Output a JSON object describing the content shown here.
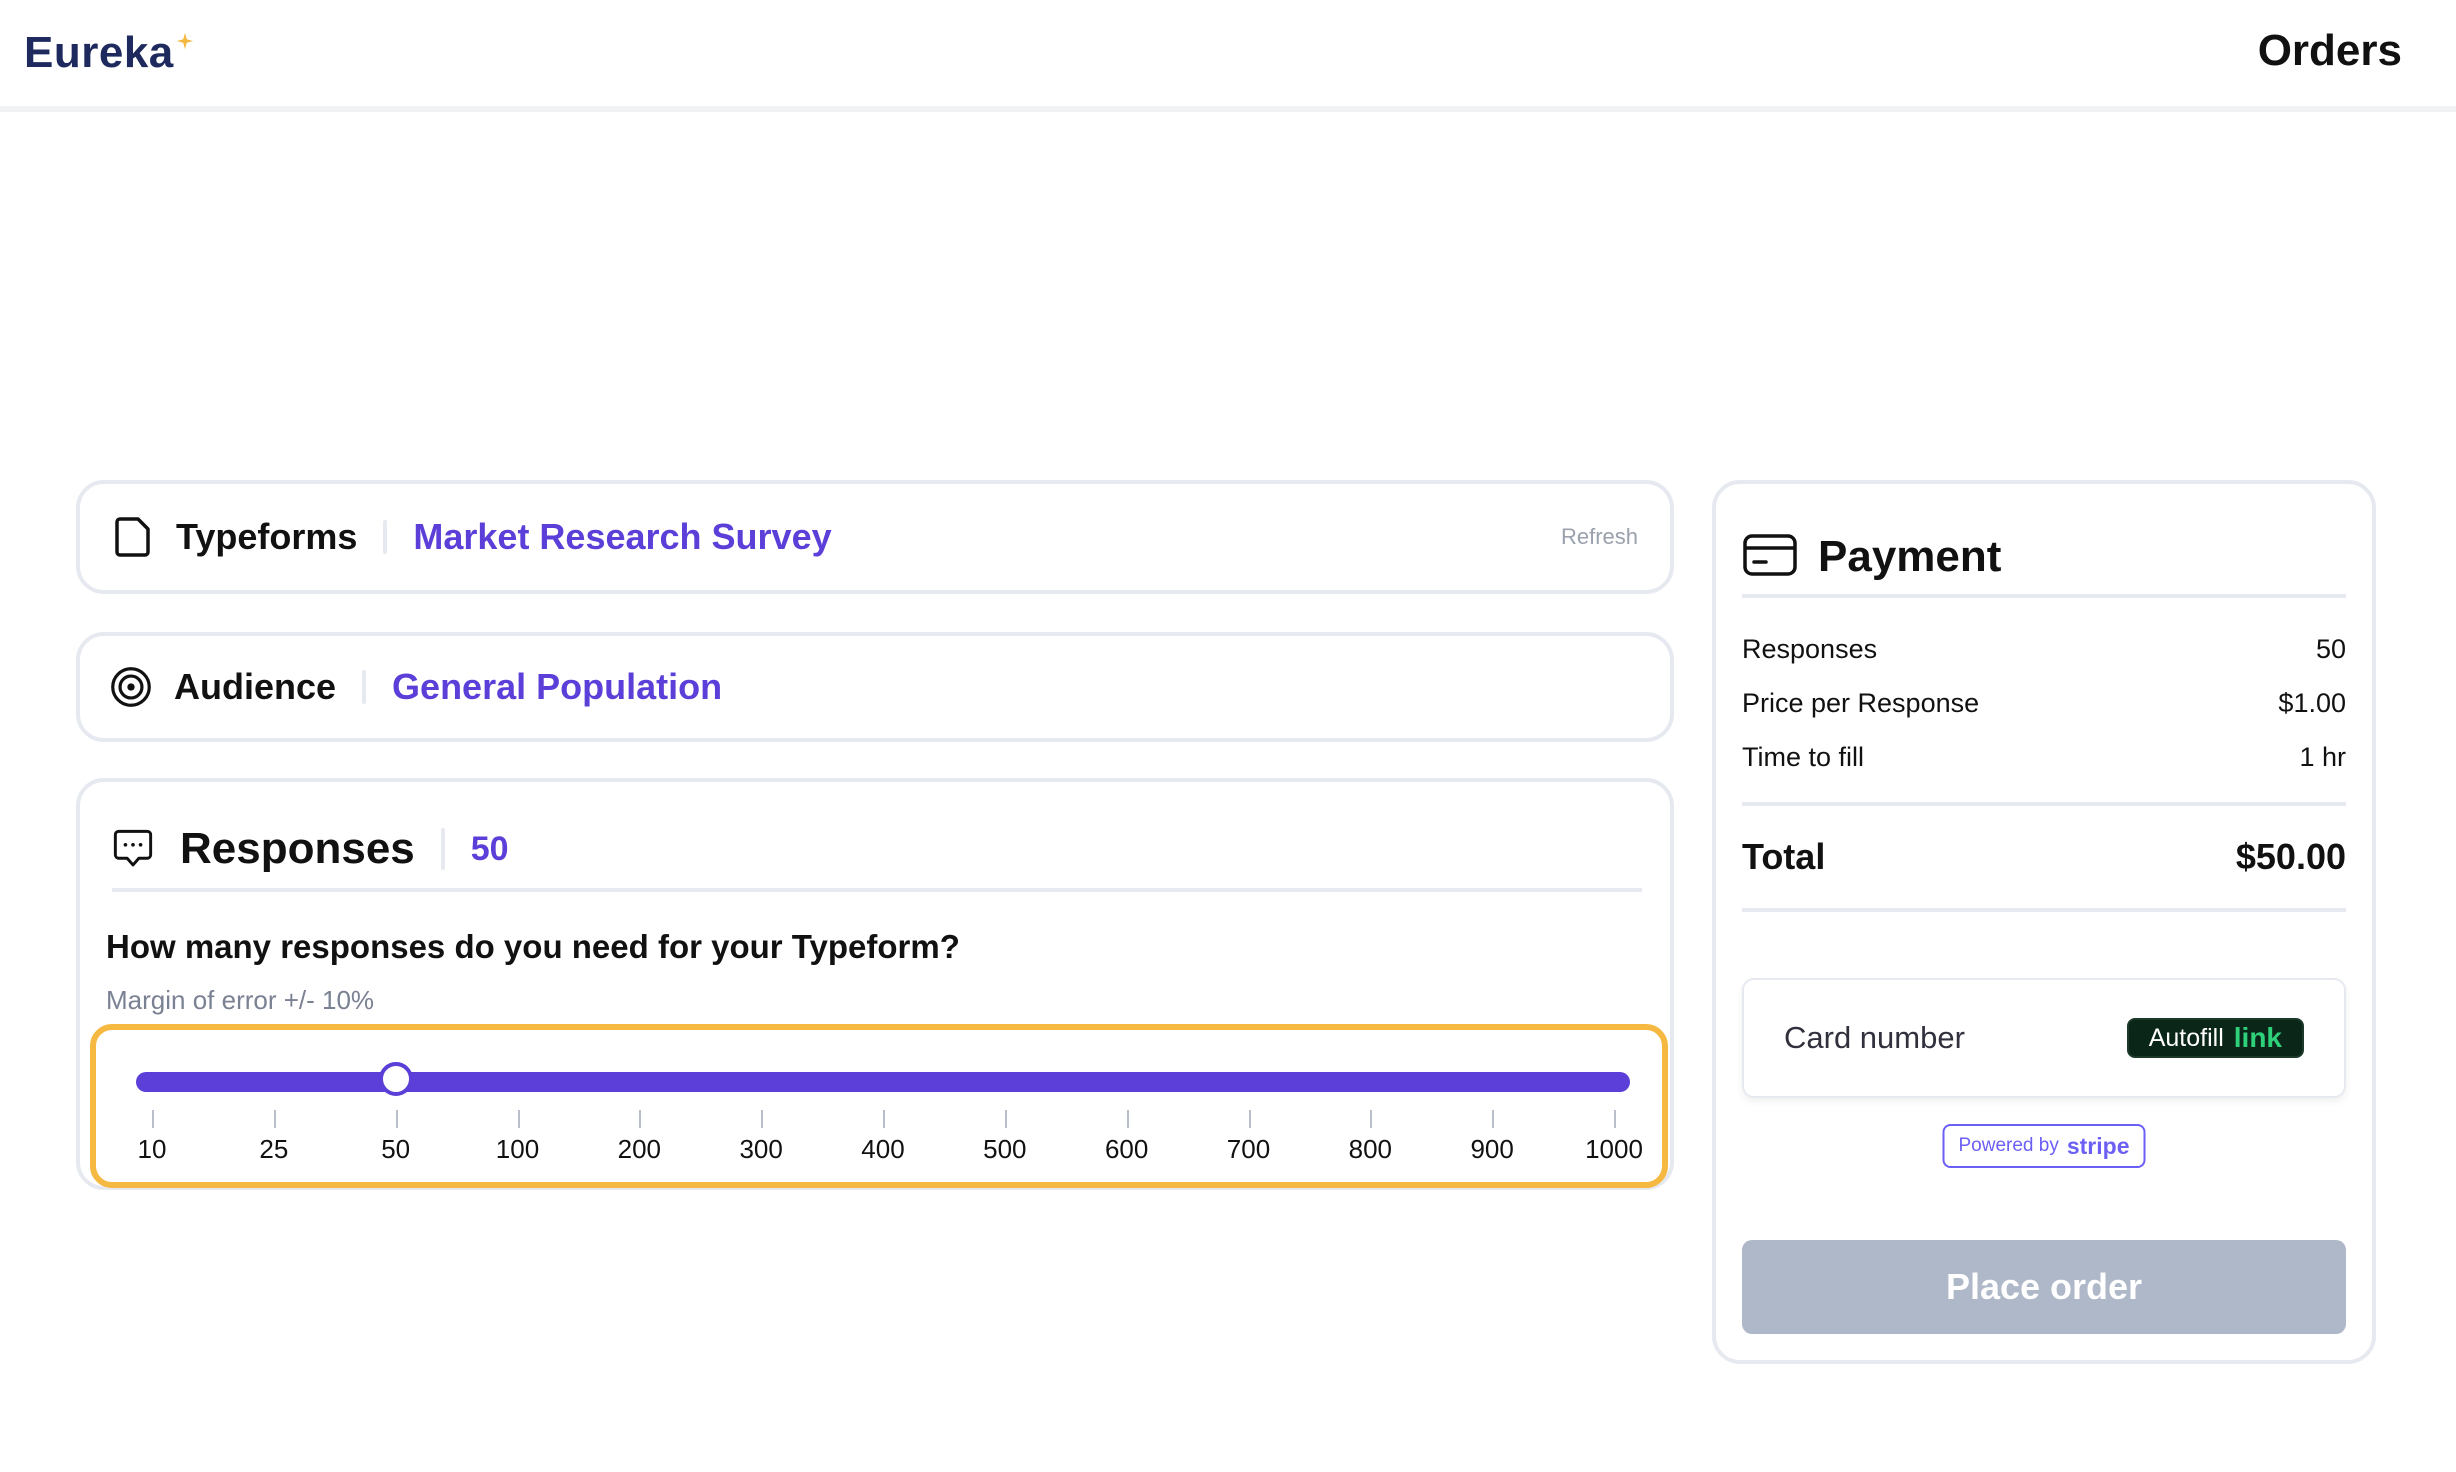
{
  "header": {
    "logo_text": "Eureka",
    "page_title": "Orders"
  },
  "typeforms": {
    "label": "Typeforms",
    "value": "Market Research Survey",
    "refresh_label": "Refresh",
    "icon": "document-icon"
  },
  "audience": {
    "label": "Audience",
    "value": "General Population",
    "icon": "target-icon"
  },
  "responses": {
    "label": "Responses",
    "value": "50",
    "icon": "chat-bubble-icon",
    "question": "How many responses do you need for your Typeform?",
    "margin_note": "Margin of error +/- 10%",
    "slider": {
      "ticks": [
        "10",
        "25",
        "50",
        "100",
        "200",
        "300",
        "400",
        "500",
        "600",
        "700",
        "800",
        "900",
        "1000"
      ],
      "selected_index": 2
    }
  },
  "payment": {
    "title": "Payment",
    "icon": "credit-card-icon",
    "rows": [
      {
        "label": "Responses",
        "value": "50"
      },
      {
        "label": "Price per Response",
        "value": "$1.00"
      },
      {
        "label": "Time to fill",
        "value": "1 hr"
      }
    ],
    "total_label": "Total",
    "total_value": "$50.00",
    "card_number_label": "Card number",
    "autofill_label": "Autofill",
    "autofill_link": "link",
    "stripe_prefix": "Powered by",
    "stripe_word": "stripe",
    "place_order_label": "Place order"
  },
  "colors": {
    "accent": "#5b3fd8",
    "highlight": "#f5b841",
    "logo": "#1e2a5e",
    "disabled_button": "#aeb8c9",
    "link_green": "#2fd07a"
  }
}
